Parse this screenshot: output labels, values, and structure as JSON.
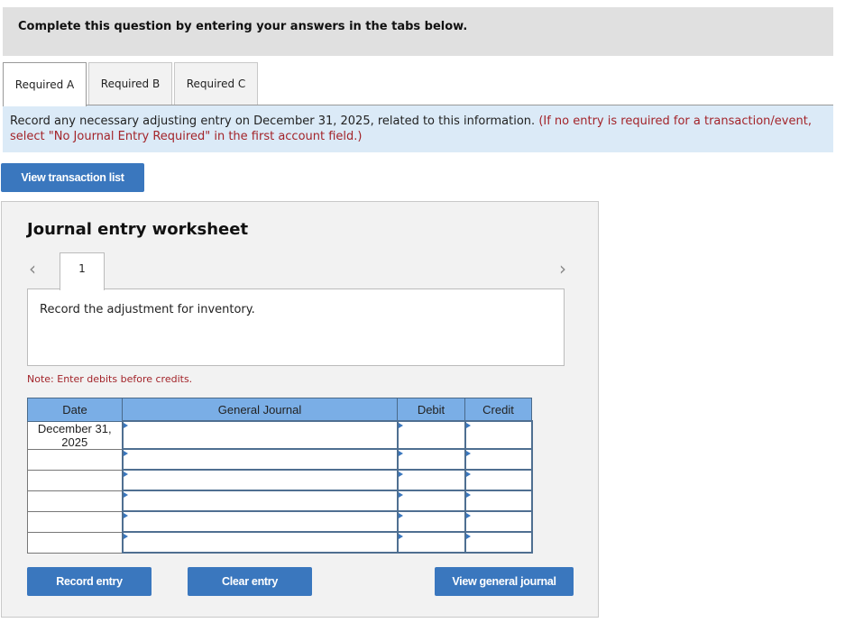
{
  "header": {
    "text": "Complete this question by entering your answers in the tabs below."
  },
  "tabs": [
    {
      "label": "Required A",
      "active": true
    },
    {
      "label": "Required B",
      "active": false
    },
    {
      "label": "Required C",
      "active": false
    }
  ],
  "instructions": {
    "main": "Record any necessary adjusting entry on December 31, 2025, related to this information.",
    "note": "(If no entry is required for a transaction/event, select \"No Journal Entry Required\" in the first account field.)"
  },
  "view_transaction_list_label": "View transaction list",
  "worksheet": {
    "title": "Journal entry worksheet",
    "entry_tab": "1",
    "prev_icon": "chevron-left-icon",
    "next_icon": "chevron-right-icon",
    "description": "Record the adjustment for inventory.",
    "note": "Note: Enter debits before credits.",
    "table": {
      "headers": [
        "Date",
        "General Journal",
        "Debit",
        "Credit"
      ],
      "rows": [
        {
          "date": "December 31, 2025",
          "account": "",
          "debit": "",
          "credit": ""
        },
        {
          "date": "",
          "account": "",
          "debit": "",
          "credit": ""
        },
        {
          "date": "",
          "account": "",
          "debit": "",
          "credit": ""
        },
        {
          "date": "",
          "account": "",
          "debit": "",
          "credit": ""
        },
        {
          "date": "",
          "account": "",
          "debit": "",
          "credit": ""
        },
        {
          "date": "",
          "account": "",
          "debit": "",
          "credit": ""
        }
      ]
    },
    "buttons": {
      "record": "Record entry",
      "clear": "Clear entry",
      "view_journal": "View general journal"
    }
  },
  "colors": {
    "accent": "#3a77be",
    "header_blue": "#7aaee6",
    "note_red": "#a3242a",
    "instruction_bg": "#dbeaf7"
  }
}
